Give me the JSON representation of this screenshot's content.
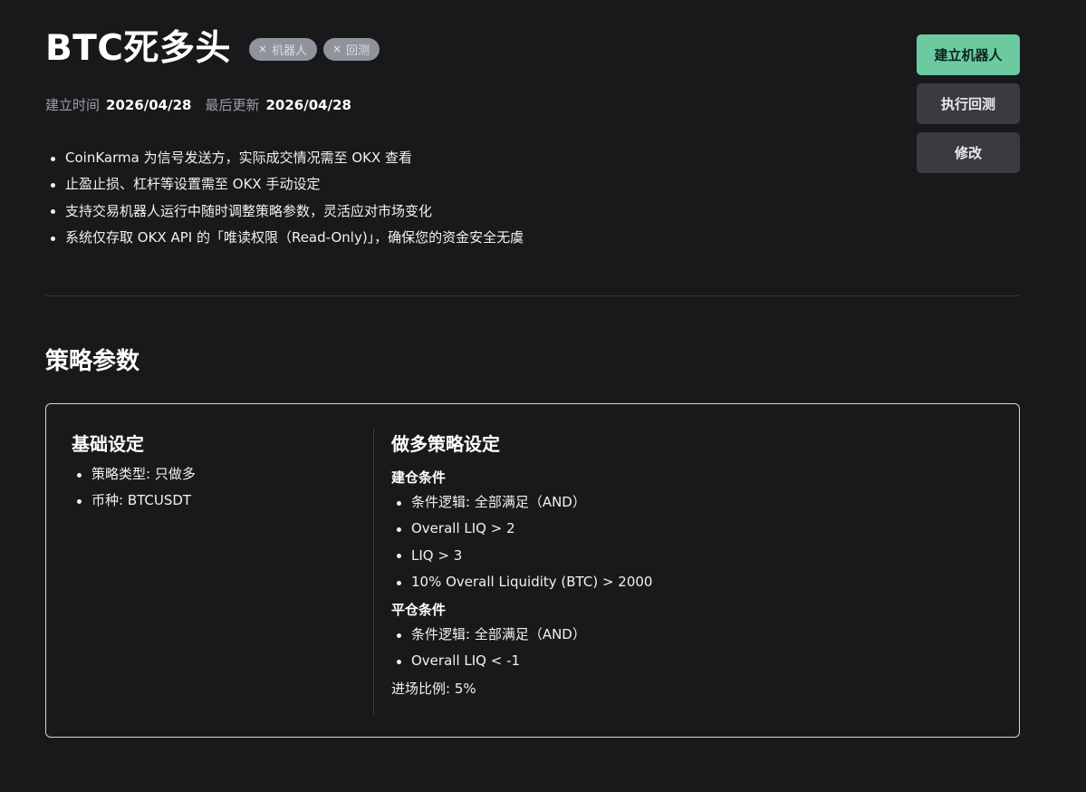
{
  "header": {
    "title": "BTC死多头",
    "tags": [
      {
        "icon": "close-icon",
        "close_glyph": "×",
        "label": "机器人"
      },
      {
        "icon": "close-icon",
        "close_glyph": "×",
        "label": "回测"
      }
    ]
  },
  "meta": {
    "created_label": "建立时间",
    "created_value": "2026/04/28",
    "updated_label": "最后更新",
    "updated_value": "2026/04/28"
  },
  "notes": [
    "CoinKarma 为信号发送方，实际成交情况需至 OKX 查看",
    "止盈止损、杠杆等设置需至 OKX 手动设定",
    "支持交易机器人运行中随时调整策略参数，灵活应对市场变化",
    "系统仅存取 OKX API 的「唯读权限（Read-Only)」，确保您的资金安全无虞"
  ],
  "actions": {
    "create_bot": "建立机器人",
    "run_backtest": "执行回测",
    "edit": "修改"
  },
  "strategy": {
    "section_title": "策略参数",
    "basic": {
      "title": "基础设定",
      "items": [
        "策略类型: 只做多",
        "币种: BTCUSDT"
      ]
    },
    "long": {
      "title": "做多策略设定",
      "entry_title": "建仓条件",
      "entry_items": [
        "条件逻辑: 全部满足（AND）",
        "Overall LIQ > 2",
        "LIQ > 3",
        "10% Overall Liquidity (BTC) > 2000"
      ],
      "exit_title": "平仓条件",
      "exit_items": [
        "条件逻辑: 全部满足（AND）",
        "Overall LIQ < -1"
      ],
      "entry_ratio": "进场比例: 5%"
    }
  },
  "colors": {
    "background": "#19191c",
    "primary_button": "#6ccaa1",
    "secondary_button": "#3a3a3f",
    "tag_background": "#8f939b"
  }
}
